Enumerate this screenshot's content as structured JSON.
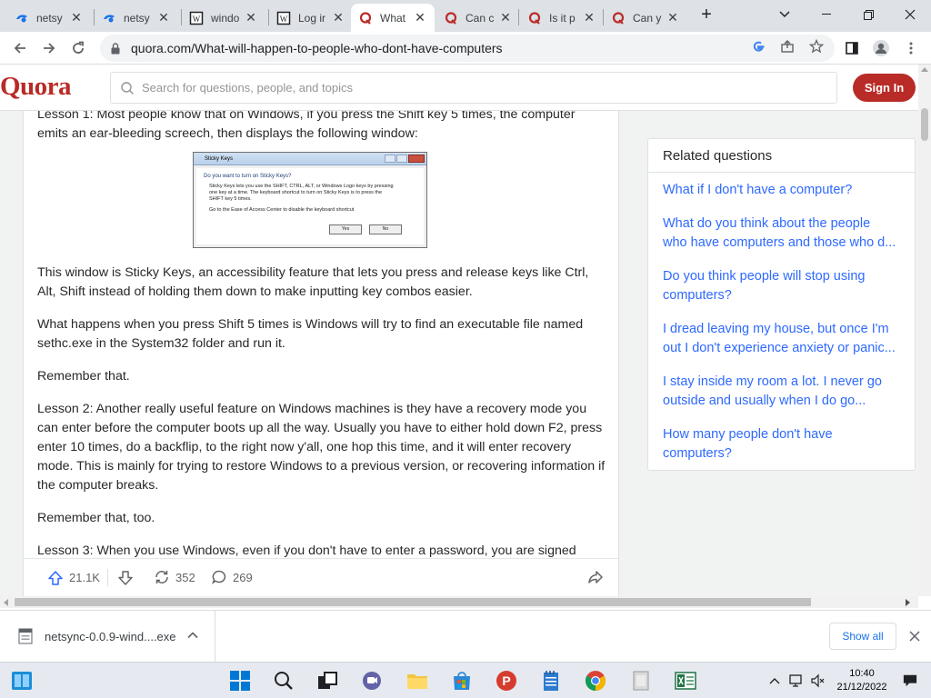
{
  "browser": {
    "tabs": [
      {
        "label": "netsy",
        "icon": "netsync-icon",
        "active": false
      },
      {
        "label": "netsy",
        "icon": "netsync-icon",
        "active": false
      },
      {
        "label": "windo",
        "icon": "wikipedia-icon",
        "active": false
      },
      {
        "label": "Log ir",
        "icon": "wikipedia-icon",
        "active": false
      },
      {
        "label": "What",
        "icon": "quora-icon",
        "active": true
      },
      {
        "label": "Can c",
        "icon": "quora-icon",
        "active": false
      },
      {
        "label": "Is it p",
        "icon": "quora-icon",
        "active": false
      },
      {
        "label": "Can y",
        "icon": "quora-icon",
        "active": false
      }
    ],
    "new_tab": "+",
    "url": "quora.com/What-will-happen-to-people-who-dont-have-computers"
  },
  "quora": {
    "logo": "Quora",
    "search_placeholder": "Search for questions, people, and topics",
    "sign_in": "Sign In"
  },
  "answer": {
    "paragraphs_before_image": [
      "Lesson 1: Most people know that on Windows, if you press the Shift key 5 times, the computer emits an ear-bleeding screech, then displays the following window:"
    ],
    "image_dialog": {
      "title": "Sticky Keys",
      "heading": "Do you want to turn on Sticky Keys?",
      "line1": "Sticky Keys lets you use the SHIFT, CTRL, ALT, or Windows Logo keys by pressing",
      "line2": "one key at a time. The keyboard shortcut to turn on Sticky Keys is to press the",
      "line3": "SHIFT key 5 times.",
      "line4": "Go to the Ease of Access Center to disable the keyboard shortcut",
      "yes": "Yes",
      "no": "No"
    },
    "paragraphs_after_image": [
      "This window is Sticky Keys, an accessibility feature that lets you press and release keys like Ctrl, Alt, Shift instead of holding them down to make inputting key combos easier.",
      "What happens when you press Shift 5 times is Windows will try to find an executable file named sethc.exe in the System32 folder and run it.",
      "Remember that.",
      "Lesson 2: Another really useful feature on Windows machines is they have a recovery mode you can enter before the computer boots up all the way. Usually you have to either hold down F2, press enter 10 times, do a backflip, to the right now y'all, one hop this time, and it will enter recovery mode. This is mainly for trying to restore Windows to a previous version, or recovering information if the computer breaks.",
      "Remember that, too.",
      "Lesson 3: When you use Windows, even if you don't have to enter a password, you are signed"
    ],
    "upvotes": "21.1K",
    "shares": "352",
    "comments": "269"
  },
  "related": {
    "heading": "Related questions",
    "items": [
      [
        "What if I don't have a computer?"
      ],
      [
        "What do you think about the people",
        "who have computers and those who d..."
      ],
      [
        "Do you think people will stop using",
        "computers?"
      ],
      [
        "I dread leaving my house, but once I'm",
        "out I don't experience anxiety or panic..."
      ],
      [
        "I stay inside my room a lot. I never go",
        "outside and usually when I do go..."
      ],
      [
        "How many people don't have",
        "computers?"
      ]
    ]
  },
  "downloads": {
    "file": "netsync-0.0.9-wind....exe",
    "show_all": "Show all"
  },
  "taskbar": {
    "time": "10:40",
    "date": "21/12/2022"
  },
  "colors": {
    "quora_red": "#b92b27",
    "link_blue": "#2e69ff",
    "text": "#282829"
  }
}
